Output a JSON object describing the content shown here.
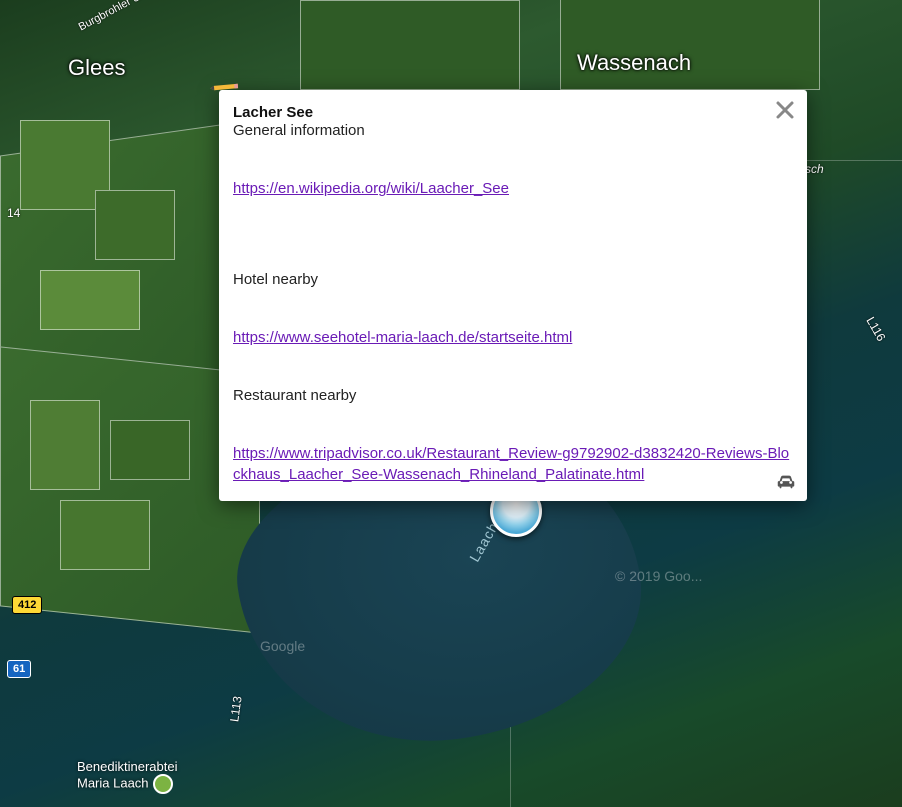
{
  "towns": {
    "glees": "Glees",
    "wassenach": "Wassenach",
    "maria_laach": "Benediktinerabtei\nMaria Laach"
  },
  "roads": {
    "r412": "412",
    "r61": "61",
    "r14": "14",
    "l113": "L113",
    "l116": "L116",
    "burgbrohler": "Burgbrohler S..."
  },
  "lake_label": "Laache",
  "attrib": {
    "a": "© 2019 Goo...",
    "b": "Google"
  },
  "popup": {
    "title": "Lacher See",
    "general": "General information",
    "link_wiki": "https://en.wikipedia.org/wiki/Laacher_See",
    "hotel": "Hotel nearby",
    "link_hotel": "https://www.seehotel-maria-laach.de/startseite.html",
    "restaurant": "Restaurant nearby",
    "link_rest": "https://www.tripadvisor.co.uk/Restaurant_Review-g9792902-d3832420-Reviews-Blockhaus_Laacher_See-Wassenach_Rhineland_Palatinate.html"
  }
}
